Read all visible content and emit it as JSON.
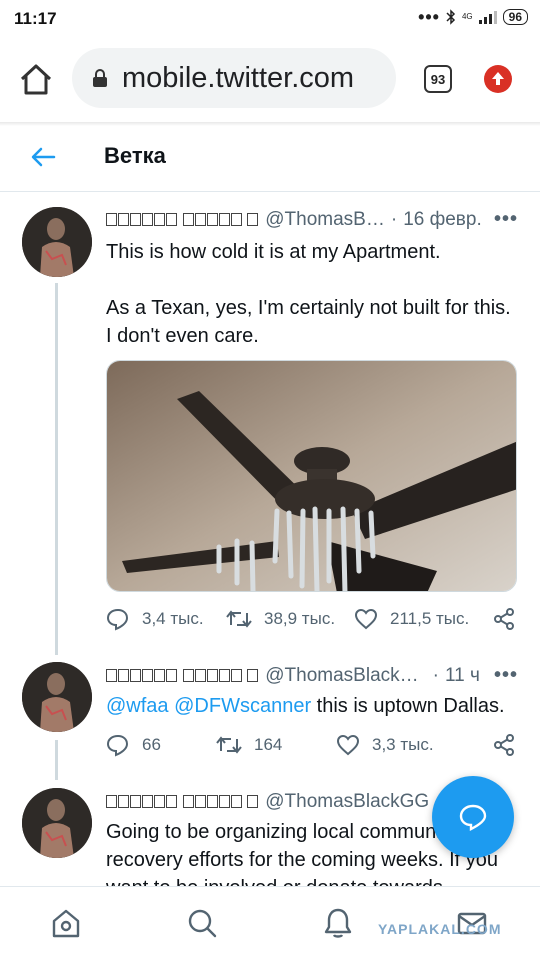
{
  "status_bar": {
    "time": "11:17",
    "dots": "•••",
    "network_top": "4G",
    "network_bottom": "ᵢₗ",
    "battery": "96"
  },
  "browser": {
    "url": "mobile.twitter.com",
    "tab_count": "93"
  },
  "header": {
    "title": "Ветка"
  },
  "tweets": [
    {
      "display_name": " ",
      "handle": "@ThomasB…",
      "separator": "·",
      "time": "16 февр.",
      "text_line1": "This is how cold it is at my Apartment.",
      "text_para2": "As a Texan, yes, I'm certainly not built for this. I don't even care.",
      "replies": "3,4 тыс.",
      "retweets": "38,9 тыс.",
      "likes": "211,5 тыс."
    },
    {
      "handle": "@ThomasBlack…",
      "separator": "·",
      "time": "11 ч",
      "mention1": "@wfaa",
      "mention2": "@DFWscanner",
      "text": " this is uptown Dallas.",
      "replies": "66",
      "retweets": "164",
      "likes": "3,3 тыс."
    },
    {
      "handle": "@ThomasBlackGG",
      "separator": "·",
      "text": "Going to be organizing local community recovery efforts for the coming weeks. If you want to be involved or donate towards"
    }
  ],
  "watermark": "YAPLAKAL.COM",
  "colors": {
    "accent": "#1d9bf0",
    "text": "#0f1419",
    "muted": "#536471"
  }
}
